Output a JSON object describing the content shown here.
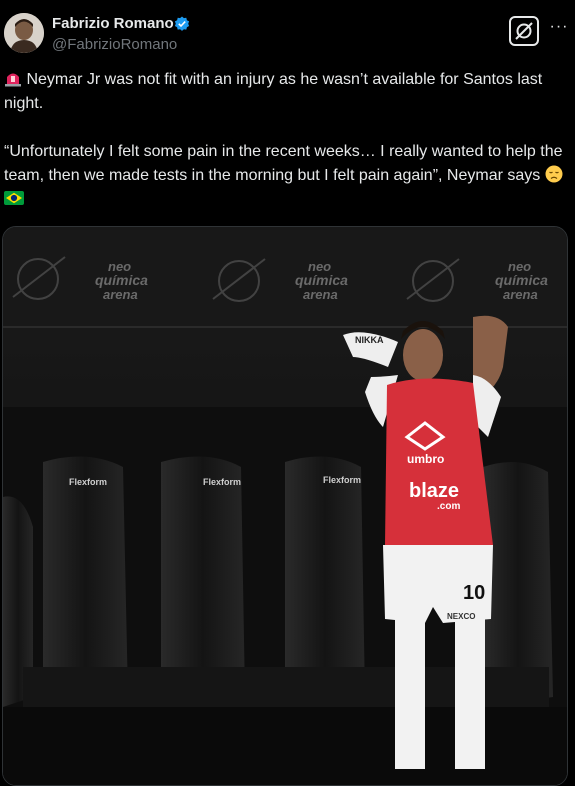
{
  "author": {
    "name": "Fabrizio Romano",
    "handle": "@FabrizioRomano",
    "verified": true,
    "verified_color": "#1d9bf0"
  },
  "icons": {
    "grok": "grok-icon",
    "more": "more-horizontal-icon",
    "siren": "siren-emoji",
    "disappointed": "disappointed-face-emoji",
    "flag": "brazil-flag-emoji"
  },
  "tweet": {
    "line1": "Neymar Jr was not fit with an injury as he wasn’t available for Santos last night.",
    "quote": "“Unfortunately I felt some pain in the recent weeks… I really wanted to help the team, then we made tests in the morning but I felt pain again”, Neymar says"
  },
  "media": {
    "description_alt": "Neymar standing by the bench",
    "wall_text": [
      "neo",
      "química",
      "arena"
    ],
    "seat_brand": "Flexform",
    "bib_brand": "umbro",
    "bib_sponsor": "blaze",
    "bib_sponsor_suffix": ".com",
    "shorts_number": "10",
    "sleeve_text": "NIKKA",
    "shorts_brand": "NEXCO"
  },
  "colors": {
    "background": "#000000",
    "text": "#e7e9ea",
    "secondary_text": "#71767b",
    "bib_red": "#d6303a"
  }
}
